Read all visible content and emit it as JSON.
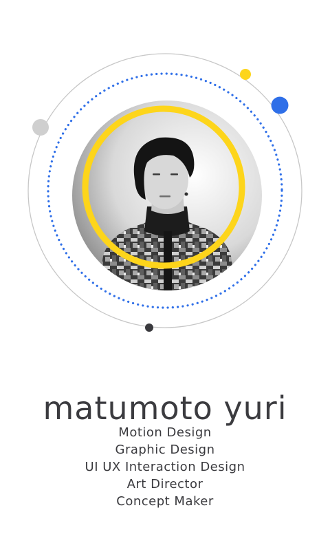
{
  "profile": {
    "name": "matumoto yuri",
    "roles": [
      "Motion Design",
      "Graphic Design",
      "UI UX Interaction Design",
      "Art Director",
      "Concept Maker"
    ]
  },
  "colors": {
    "accent_yellow": "#fdd51b",
    "accent_blue": "#2f6fe8",
    "orbit_gray": "#bdbdbd",
    "dot_gray": "#cfcfcf",
    "dot_dark": "#3a3a3e",
    "text": "#3b3b3f"
  }
}
